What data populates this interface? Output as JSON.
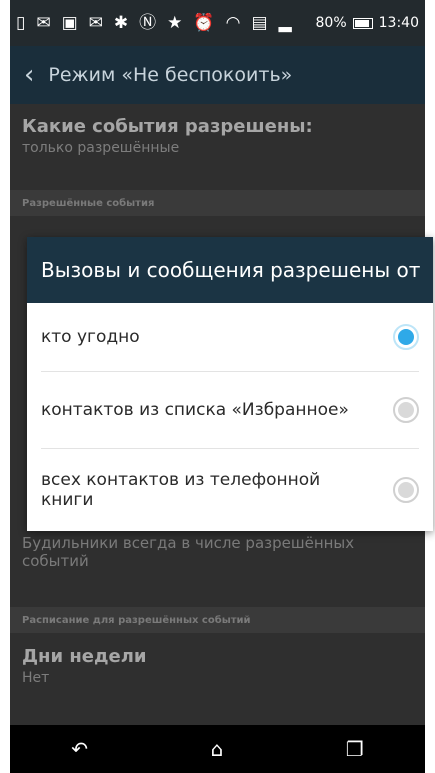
{
  "status_bar": {
    "icons": [
      "sim-icon",
      "mail-icon",
      "gallery-icon",
      "mail-icon",
      "bluetooth-icon",
      "nfc-icon",
      "star-icon",
      "alarm-icon",
      "wifi-icon",
      "calendar-icon",
      "signal-icon"
    ],
    "battery_text": "80%",
    "time": "13:40"
  },
  "app_bar": {
    "title": "Режим «Не беспокоить»"
  },
  "background": {
    "setting1_title": "Какие события разрешены:",
    "setting1_sub": "только разрешённые",
    "section1": "Разрешённые события",
    "alarms_text": "Будильники всегда в числе разрешённых событий",
    "section2": "Расписание для разрешённых событий",
    "days_title": "Дни недели",
    "days_value": "Нет"
  },
  "dialog": {
    "title": "Вызовы и сообщения разрешены от",
    "options": [
      {
        "label": "кто угодно",
        "selected": true
      },
      {
        "label": "контактов из списка «Избранное»",
        "selected": false
      },
      {
        "label": "всех контактов из телефонной книги",
        "selected": false
      }
    ]
  },
  "colors": {
    "accent": "#2fa9e8",
    "app_bar": "#1a2e3b",
    "dialog_header": "#1b3444"
  }
}
